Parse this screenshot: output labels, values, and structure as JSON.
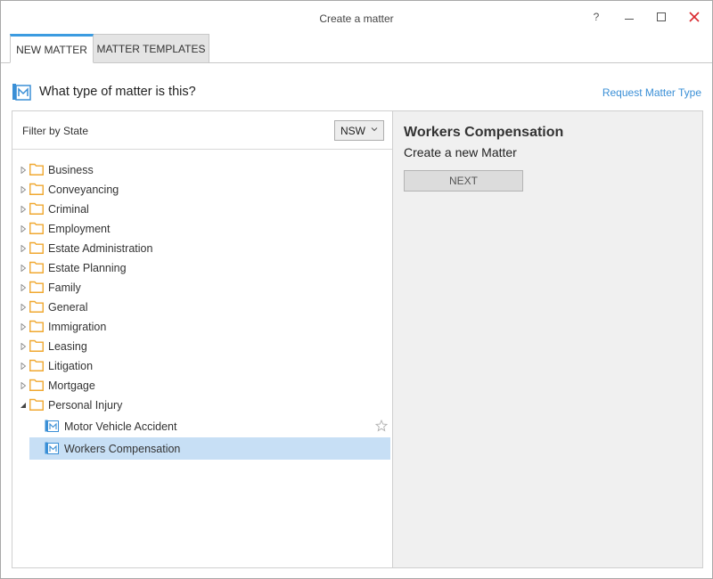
{
  "window": {
    "title": "Create a matter",
    "help_label": "?"
  },
  "tabs": [
    {
      "label": "NEW MATTER",
      "active": true
    },
    {
      "label": "MATTER TEMPLATES",
      "active": false
    }
  ],
  "header": {
    "title": "What type of matter is this?",
    "request_link": "Request Matter Type"
  },
  "filter": {
    "label": "Filter by State",
    "selected_state": "NSW"
  },
  "tree": {
    "categories": [
      {
        "label": "Business",
        "expanded": false
      },
      {
        "label": "Conveyancing",
        "expanded": false
      },
      {
        "label": "Criminal",
        "expanded": false
      },
      {
        "label": "Employment",
        "expanded": false
      },
      {
        "label": "Estate Administration",
        "expanded": false
      },
      {
        "label": "Estate Planning",
        "expanded": false
      },
      {
        "label": "Family",
        "expanded": false
      },
      {
        "label": "General",
        "expanded": false
      },
      {
        "label": "Immigration",
        "expanded": false
      },
      {
        "label": "Leasing",
        "expanded": false
      },
      {
        "label": "Litigation",
        "expanded": false
      },
      {
        "label": "Mortgage",
        "expanded": false
      },
      {
        "label": "Personal Injury",
        "expanded": true
      }
    ],
    "children": [
      {
        "label": "Motor Vehicle Accident",
        "selected": false
      },
      {
        "label": "Workers Compensation",
        "selected": true
      }
    ]
  },
  "detail": {
    "title": "Workers Compensation",
    "subtitle": "Create a new Matter",
    "next_label": "NEXT"
  },
  "colors": {
    "accent": "#3b9be0",
    "link": "#3a8fd6",
    "folder": "#f0a830",
    "selected_row": "#c7dff5",
    "matter_icon": "#3a8fd6"
  },
  "icons": {
    "folder": "folder-icon",
    "matter": "matter-document-icon",
    "star": "star-outline-icon",
    "expander_collapsed": "triangle-right-icon",
    "expander_expanded": "triangle-down-icon"
  }
}
